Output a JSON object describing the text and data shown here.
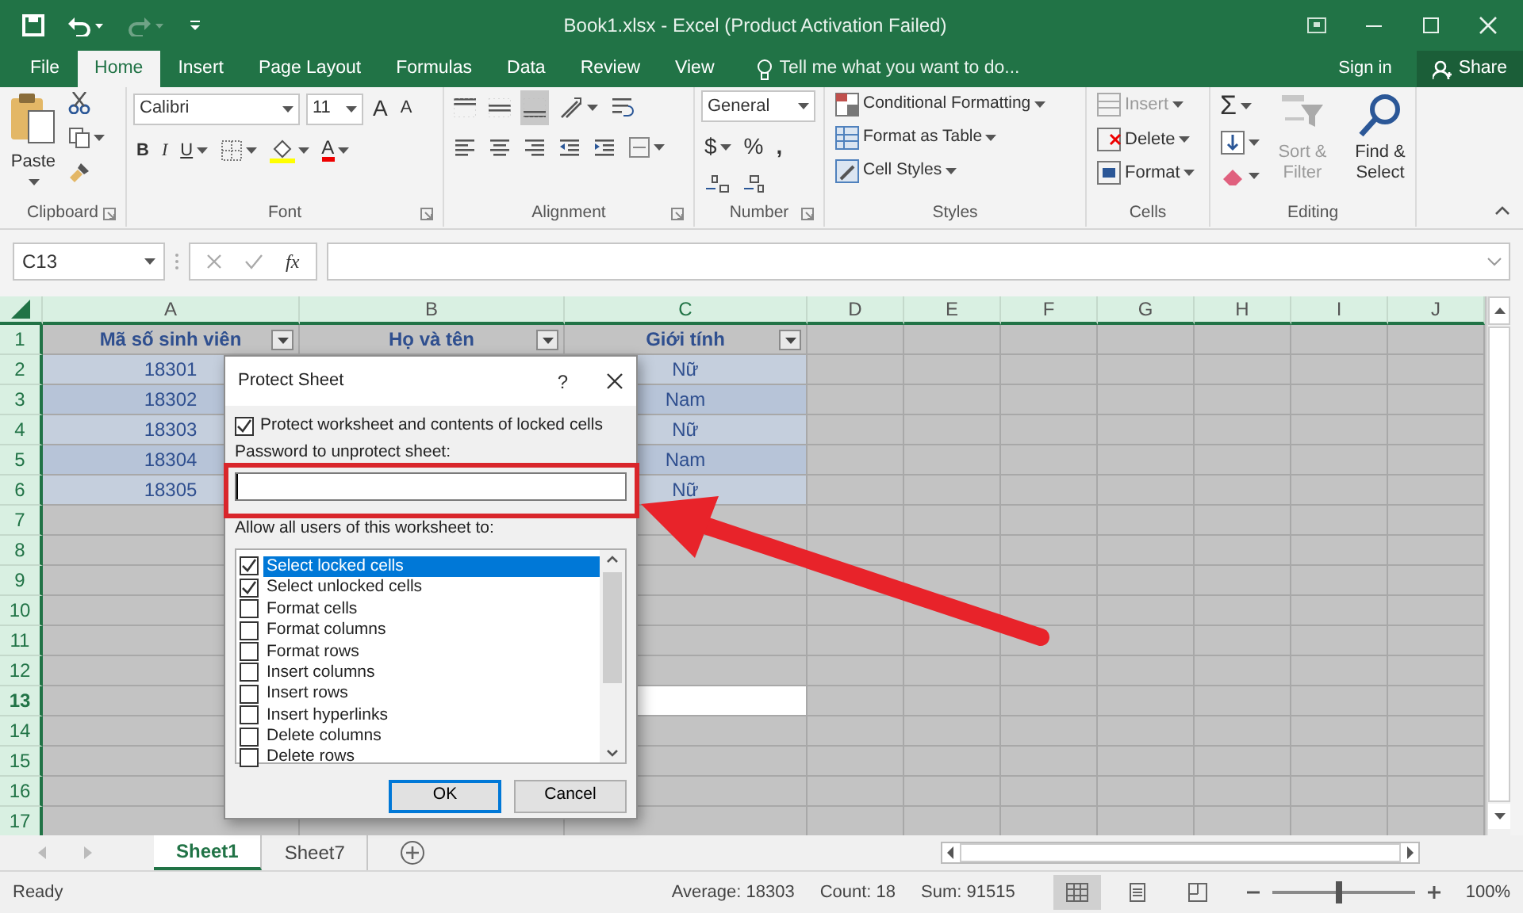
{
  "title_bar": {
    "title": "Book1.xlsx - Excel (Product Activation Failed)"
  },
  "qat": [
    {
      "kind": "save",
      "disabled": false
    },
    {
      "kind": "undo",
      "disabled": false
    },
    {
      "kind": "redo",
      "disabled": true
    },
    {
      "kind": "customize",
      "disabled": false
    }
  ],
  "menu_tabs": [
    {
      "label": "File",
      "selected": false
    },
    {
      "label": "Home",
      "selected": true
    },
    {
      "label": "Insert",
      "selected": false
    },
    {
      "label": "Page Layout",
      "selected": false
    },
    {
      "label": "Formulas",
      "selected": false
    },
    {
      "label": "Data",
      "selected": false
    },
    {
      "label": "Review",
      "selected": false
    },
    {
      "label": "View",
      "selected": false
    }
  ],
  "tell_me": {
    "placeholder": "Tell me what you want to do..."
  },
  "sign_in": "Sign in",
  "share": "Share",
  "ribbon": {
    "clipboard": {
      "paste": "Paste",
      "label": "Clipboard"
    },
    "font": {
      "name": "Calibri",
      "size": "11",
      "grow": "A",
      "shrink": "A",
      "bold": "B",
      "italic": "I",
      "underline": "U",
      "font_color": "A",
      "label": "Font"
    },
    "alignment": {
      "vertical": [
        {
          "kind": "top",
          "selected": false
        },
        {
          "kind": "middle",
          "selected": false
        },
        {
          "kind": "bottom",
          "selected": true
        }
      ],
      "label": "Alignment"
    },
    "number": {
      "format": "General",
      "currency": "$",
      "percent": "%",
      "comma": ",",
      "label": "Number"
    },
    "styles": {
      "items": [
        "Conditional Formatting",
        "Format as Table",
        "Cell Styles"
      ],
      "label": "Styles"
    },
    "cells": {
      "items": [
        {
          "label": "Insert",
          "disabled": true
        },
        {
          "label": "Delete",
          "disabled": false
        },
        {
          "label": "Format",
          "disabled": false
        }
      ],
      "label": "Cells"
    },
    "editing": {
      "autosum": "Σ",
      "sort_filter": {
        "label": "Sort & Filter",
        "disabled": true
      },
      "find": "Find & Select",
      "label": "Editing"
    }
  },
  "formula_bar": {
    "name_box": "C13",
    "fx": "fx"
  },
  "sheet": {
    "columns": [
      {
        "label": "A",
        "active": false
      },
      {
        "label": "B",
        "active": false
      },
      {
        "label": "C",
        "active": true
      },
      {
        "label": "D",
        "active": false
      },
      {
        "label": "E",
        "active": false
      },
      {
        "label": "F",
        "active": false
      },
      {
        "label": "G",
        "active": false
      },
      {
        "label": "H",
        "active": false
      },
      {
        "label": "I",
        "active": false
      },
      {
        "label": "J",
        "active": false
      }
    ],
    "rows": [
      {
        "label": "1",
        "active": false
      },
      {
        "label": "2",
        "active": false
      },
      {
        "label": "3",
        "active": false
      },
      {
        "label": "4",
        "active": false
      },
      {
        "label": "5",
        "active": false
      },
      {
        "label": "6",
        "active": false
      },
      {
        "label": "7",
        "active": false
      },
      {
        "label": "8",
        "active": false
      },
      {
        "label": "9",
        "active": false
      },
      {
        "label": "10",
        "active": false
      },
      {
        "label": "11",
        "active": false
      },
      {
        "label": "12",
        "active": false
      },
      {
        "label": "13",
        "active": true
      },
      {
        "label": "14",
        "active": false
      },
      {
        "label": "15",
        "active": false
      },
      {
        "label": "16",
        "active": false
      },
      {
        "label": "17",
        "active": false
      }
    ],
    "headers": [
      "Mã số sinh viên",
      "Họ và tên",
      "Giới tính"
    ],
    "records": [
      {
        "id": "18301",
        "gender": "Nữ"
      },
      {
        "id": "18302",
        "gender": "Nam"
      },
      {
        "id": "18303",
        "gender": "Nữ"
      },
      {
        "id": "18304",
        "gender": "Nam"
      },
      {
        "id": "18305",
        "gender": "Nữ"
      }
    ]
  },
  "dialog": {
    "title": "Protect Sheet",
    "help": "?",
    "protect_checkbox": {
      "label": "Protect worksheet and contents of locked cells",
      "checked": true
    },
    "password_label": "Password to unprotect sheet:",
    "allow_label": "Allow all users of this worksheet to:",
    "permissions": [
      {
        "label": "Select locked cells",
        "checked": true,
        "selected": true
      },
      {
        "label": "Select unlocked cells",
        "checked": true,
        "selected": false
      },
      {
        "label": "Format cells",
        "checked": false,
        "selected": false
      },
      {
        "label": "Format columns",
        "checked": false,
        "selected": false
      },
      {
        "label": "Format rows",
        "checked": false,
        "selected": false
      },
      {
        "label": "Insert columns",
        "checked": false,
        "selected": false
      },
      {
        "label": "Insert rows",
        "checked": false,
        "selected": false
      },
      {
        "label": "Insert hyperlinks",
        "checked": false,
        "selected": false
      },
      {
        "label": "Delete columns",
        "checked": false,
        "selected": false
      },
      {
        "label": "Delete rows",
        "checked": false,
        "selected": false
      }
    ],
    "buttons": [
      {
        "label": "OK",
        "default": true
      },
      {
        "label": "Cancel",
        "default": false
      }
    ]
  },
  "sheet_tabs": [
    {
      "label": "Sheet1",
      "selected": true
    },
    {
      "label": "Sheet7",
      "selected": false
    }
  ],
  "status_bar": {
    "status": "Ready",
    "average": "Average: 18303",
    "count": "Count: 18",
    "sum": "Sum: 91515",
    "views": [
      {
        "kind": "normal",
        "selected": true
      },
      {
        "kind": "page_layout",
        "selected": false
      },
      {
        "kind": "page_break",
        "selected": false
      }
    ],
    "zoom": {
      "level": 0.47,
      "reading": "100%"
    }
  }
}
